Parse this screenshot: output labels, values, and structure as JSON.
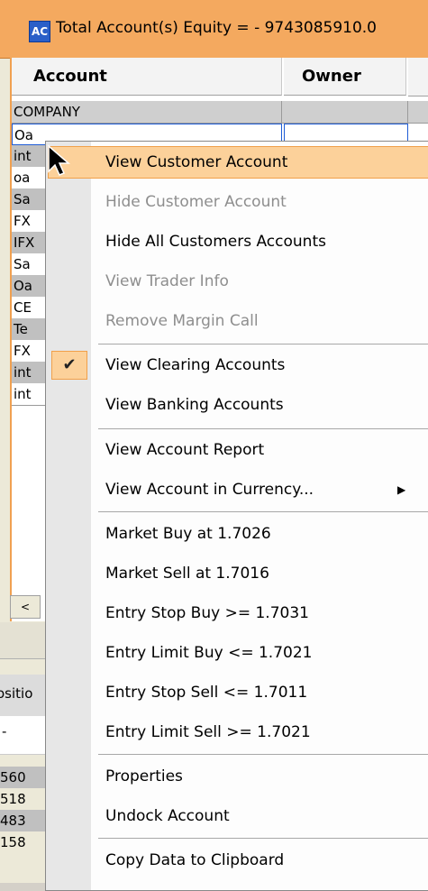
{
  "window": {
    "title": "Total Account(s) Equity = - 9743085910.0",
    "icon_text": "AC"
  },
  "grid": {
    "headers": {
      "account": "Account",
      "owner": "Owner"
    },
    "company_row": "COMPANY",
    "rows": [
      {
        "account": "Oa",
        "owner": "",
        "style": "sel"
      },
      {
        "account": "int",
        "owner": "",
        "style": "gray"
      },
      {
        "account": "oa",
        "owner": "",
        "style": "white"
      },
      {
        "account": "Sa",
        "owner": "",
        "style": "gray"
      },
      {
        "account": "FX",
        "owner": "",
        "style": "white"
      },
      {
        "account": "IFX",
        "owner": "",
        "style": "gray"
      },
      {
        "account": "Sa",
        "owner": "",
        "style": "white"
      },
      {
        "account": "Oa",
        "owner": "",
        "style": "gray"
      },
      {
        "account": "CE",
        "owner": "",
        "style": "white"
      },
      {
        "account": "Te",
        "owner": "",
        "style": "gray"
      },
      {
        "account": "FX",
        "owner": "",
        "style": "white"
      },
      {
        "account": "int",
        "owner": "",
        "style": "gray"
      },
      {
        "account": "int",
        "owner": "",
        "style": "white"
      }
    ],
    "scroll_left": "<"
  },
  "bottom_panel": {
    "position_label": "ositio",
    "sub_label": "-",
    "numbers": [
      "560",
      "518",
      "483",
      "158"
    ]
  },
  "context_menu": {
    "items": [
      {
        "label": "View Customer Account",
        "state": "highlight"
      },
      {
        "label": "Hide Customer Account",
        "state": "disabled"
      },
      {
        "label": "Hide All Customers Accounts",
        "state": "normal"
      },
      {
        "label": "View Trader Info",
        "state": "disabled"
      },
      {
        "label": "Remove Margin Call",
        "state": "disabled"
      },
      {
        "label": "View Clearing Accounts",
        "state": "checked"
      },
      {
        "label": "View Banking Accounts",
        "state": "normal"
      },
      {
        "label": "View Account Report",
        "state": "normal"
      },
      {
        "label": "View Account in Currency...",
        "state": "submenu"
      },
      {
        "label": "Market Buy at 1.7026",
        "state": "normal"
      },
      {
        "label": "Market Sell at 1.7016",
        "state": "normal"
      },
      {
        "label": "Entry Stop Buy >= 1.7031",
        "state": "normal"
      },
      {
        "label": "Entry Limit Buy <= 1.7021",
        "state": "normal"
      },
      {
        "label": "Entry Stop Sell <= 1.7011",
        "state": "normal"
      },
      {
        "label": "Entry Limit Sell >= 1.7021",
        "state": "normal"
      },
      {
        "label": "Properties",
        "state": "normal"
      },
      {
        "label": "Undock Account",
        "state": "normal"
      },
      {
        "label": "Copy Data to Clipboard",
        "state": "normal"
      }
    ],
    "check_glyph": "✔",
    "submenu_glyph": "▶"
  },
  "colors": {
    "titlebar": "#f4a95f",
    "highlight": "#fcd19a",
    "highlight_border": "#f0a04a",
    "disabled_text": "#8e8e8e"
  }
}
